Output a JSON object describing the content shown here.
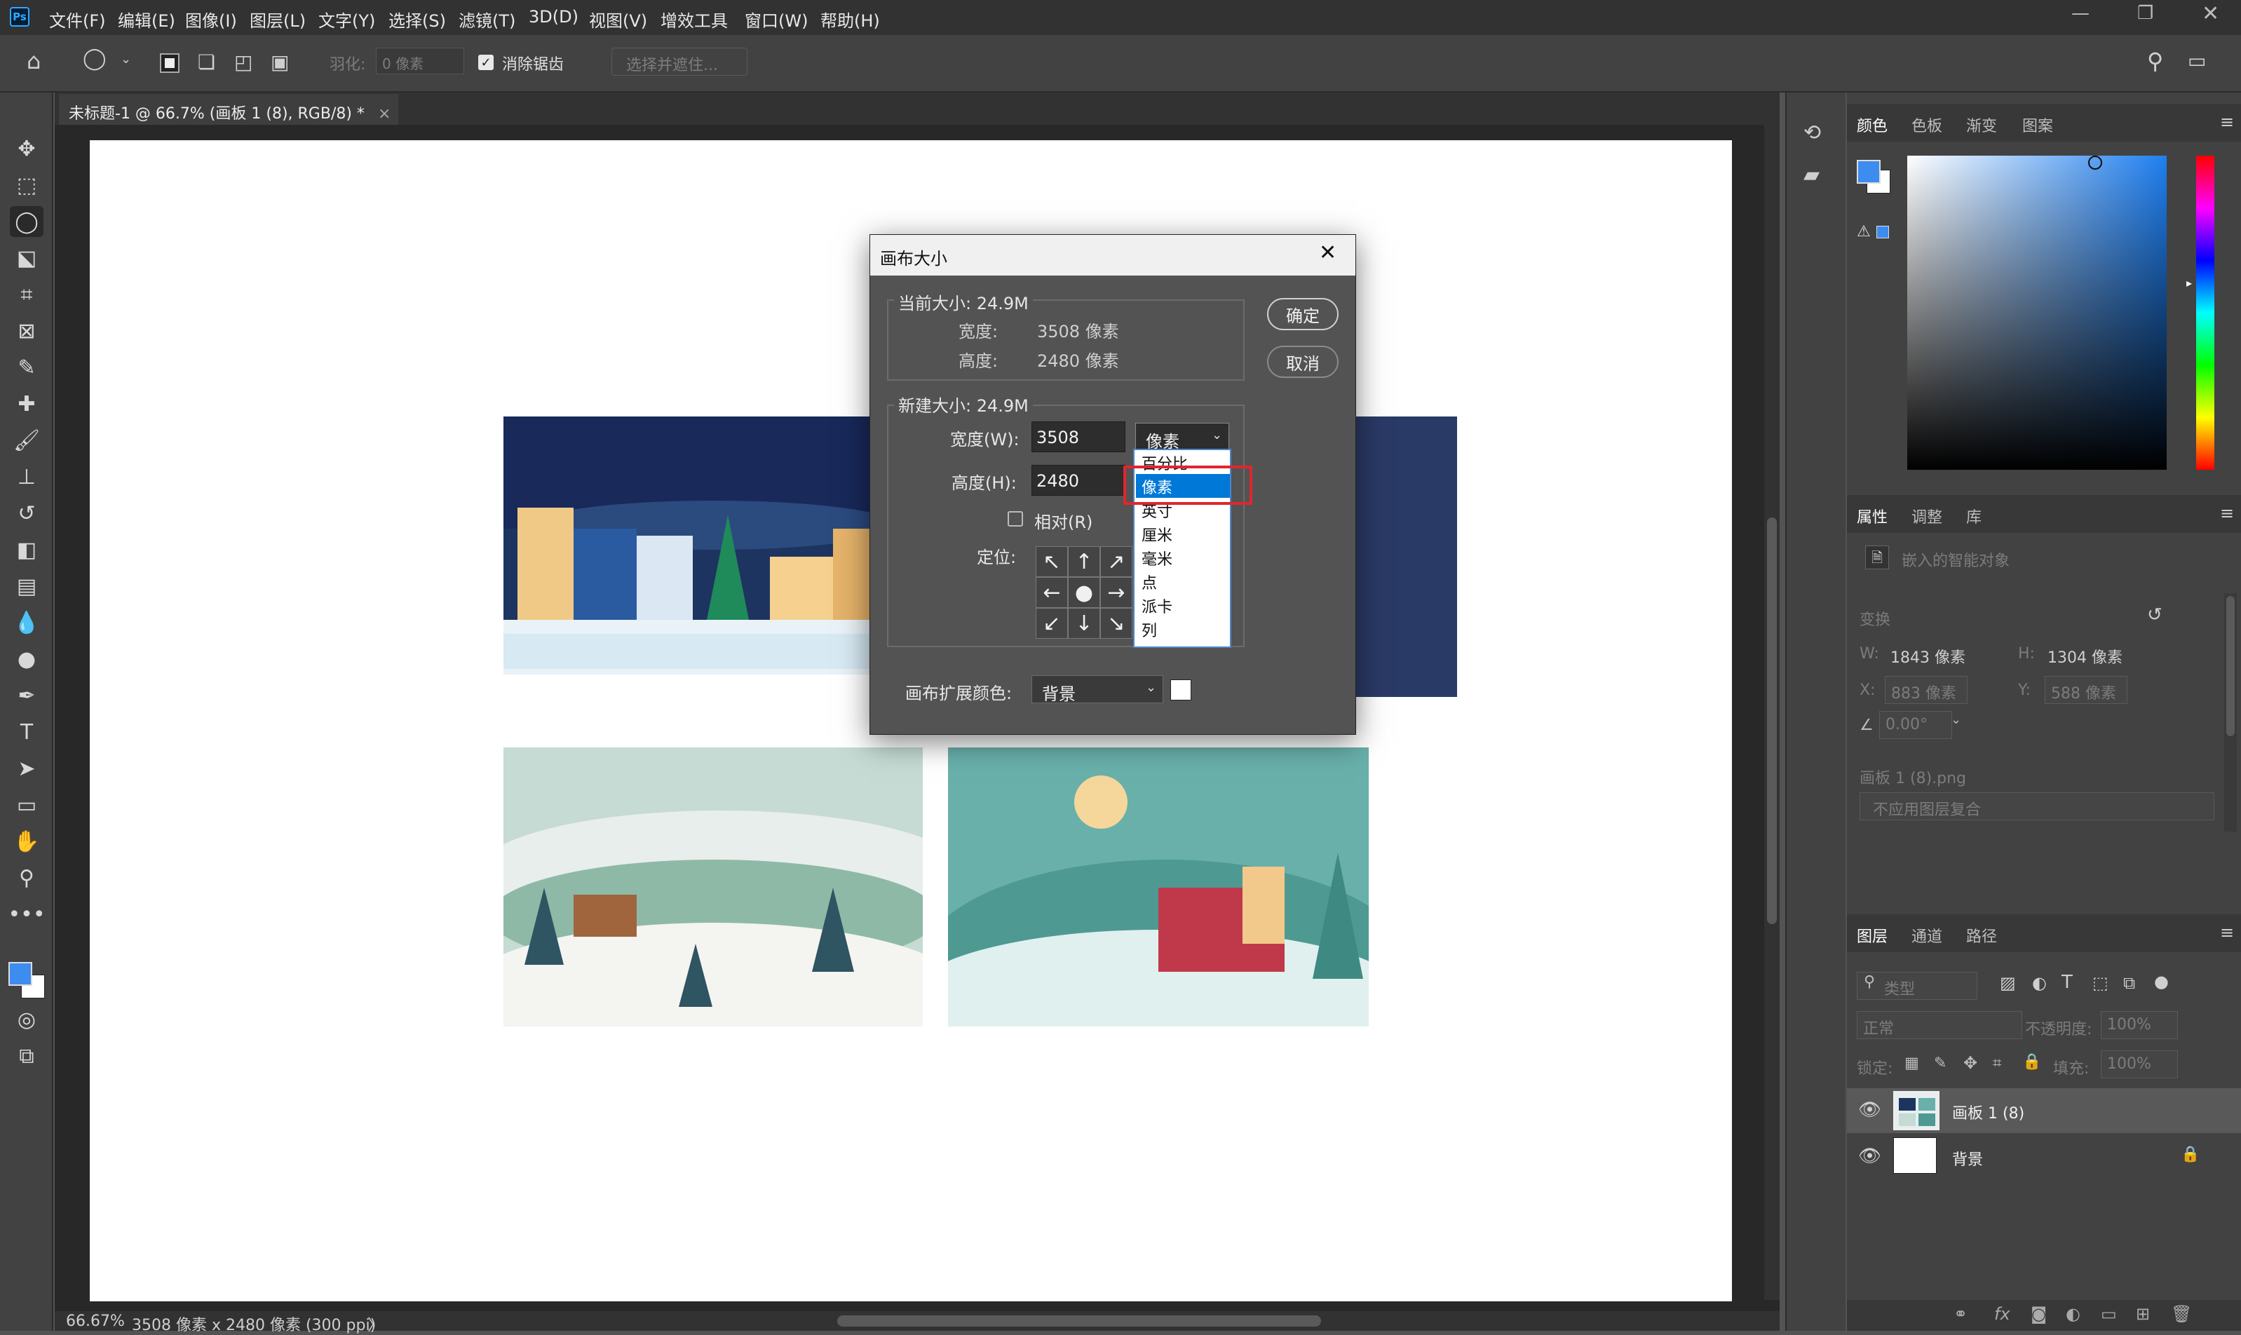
{
  "app": {
    "logo": "Ps"
  },
  "menu": [
    "文件(F)",
    "编辑(E)",
    "图像(I)",
    "图层(L)",
    "文字(Y)",
    "选择(S)",
    "滤镜(T)",
    "3D(D)",
    "视图(V)",
    "增效工具",
    "窗口(W)",
    "帮助(H)"
  ],
  "options": {
    "feather_label": "羽化:",
    "feather_value": "0 像素",
    "antialias_label": "消除锯齿",
    "select_mask": "选择并遮住..."
  },
  "tab": {
    "title": "未标题-1 @ 66.7% (画板 1 (8), RGB/8) *",
    "close": "×"
  },
  "status": {
    "zoom": "66.67%",
    "info": "3508 像素 x 2480 像素 (300 ppi)",
    "arrow": "〉"
  },
  "color_panel": {
    "tabs": [
      "颜色",
      "色板",
      "渐变",
      "图案"
    ],
    "fg_color": "#3d8cf0",
    "bg_color": "#ffffff"
  },
  "properties": {
    "tabs": [
      "属性",
      "调整",
      "库"
    ],
    "object_type": "嵌入的智能对象",
    "transform": "变换",
    "w_label": "W:",
    "w_value": "1843 像素",
    "h_label": "H:",
    "h_value": "1304 像素",
    "x_label": "X:",
    "x_value": "883 像素",
    "y_label": "Y:",
    "y_value": "588 像素",
    "angle_value": "0.00°",
    "file": "画板 1 (8).png",
    "comp": "不应用图层复合"
  },
  "layers": {
    "tabs": [
      "图层",
      "通道",
      "路径"
    ],
    "filter_kind": "类型",
    "blend_mode": "正常",
    "opacity_label": "不透明度:",
    "opacity": "100%",
    "lock_label": "锁定:",
    "fill_label": "填充:",
    "fill": "100%",
    "items": [
      {
        "name": "画板 1 (8)"
      },
      {
        "name": "背景"
      }
    ]
  },
  "dialog": {
    "title": "画布大小",
    "current_size": "当前大小: 24.9M",
    "cur_width_label": "宽度:",
    "cur_width": "3508 像素",
    "cur_height_label": "高度:",
    "cur_height": "2480 像素",
    "new_size": "新建大小: 24.9M",
    "width_label": "宽度(W):",
    "width_value": "3508",
    "unit_value": "像素",
    "height_label": "高度(H):",
    "height_value": "2480",
    "relative_label": "相对(R)",
    "anchor_label": "定位:",
    "ext_color_label": "画布扩展颜色:",
    "ext_color_value": "背景",
    "ok": "确定",
    "cancel": "取消",
    "unit_options": [
      "百分比",
      "像素",
      "英寸",
      "厘米",
      "毫米",
      "点",
      "派卡",
      "列"
    ],
    "selected_unit_index": 1,
    "highlight_color": "#e0262d"
  }
}
